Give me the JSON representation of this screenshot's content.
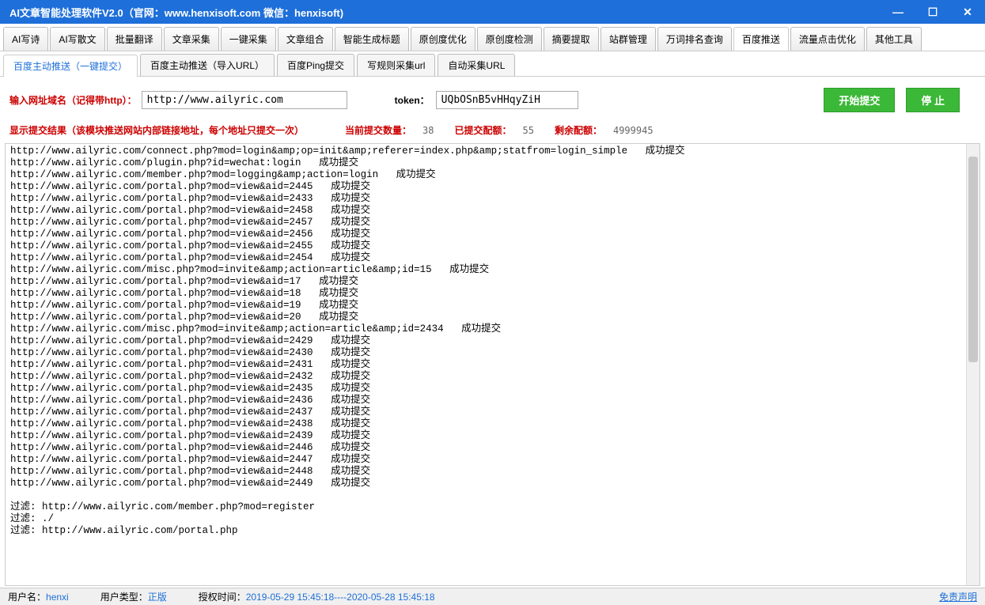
{
  "title": "AI文章智能处理软件V2.0（官网：www.henxisoft.com  微信：henxisoft)",
  "mainTabs": [
    "AI写诗",
    "AI写散文",
    "批量翻译",
    "文章采集",
    "一键采集",
    "文章组合",
    "智能生成标题",
    "原创度优化",
    "原创度检测",
    "摘要提取",
    "站群管理",
    "万词排名查询",
    "百度推送",
    "流量点击优化",
    "其他工具"
  ],
  "mainTabActive": 12,
  "subTabs": [
    "百度主动推送（一键提交）",
    "百度主动推送（导入URL）",
    "百度Ping提交",
    "写规则采集url",
    "自动采集URL"
  ],
  "subTabActive": 0,
  "form": {
    "urlLabel": "输入网址域名（记得带http）：",
    "urlValue": "http://www.ailyric.com",
    "tokenLabel": "token：",
    "tokenValue": "UQbOSnB5vHHqyZiH",
    "startBtn": "开始提交",
    "stopBtn": "停 止"
  },
  "stats": {
    "resultLabel": "显示提交结果（该模块推送网站内部链接地址，每个地址只提交一次）",
    "currentLabel": "当前提交数量：",
    "currentValue": "38",
    "submittedLabel": "已提交配额：",
    "submittedValue": "55",
    "remainLabel": "剩余配额：",
    "remainValue": "4999945"
  },
  "log": [
    "http://www.ailyric.com/connect.php?mod=login&amp;op=init&amp;referer=index.php&amp;statfrom=login_simple   成功提交",
    "http://www.ailyric.com/plugin.php?id=wechat:login   成功提交",
    "http://www.ailyric.com/member.php?mod=logging&amp;action=login   成功提交",
    "http://www.ailyric.com/portal.php?mod=view&aid=2445   成功提交",
    "http://www.ailyric.com/portal.php?mod=view&aid=2433   成功提交",
    "http://www.ailyric.com/portal.php?mod=view&aid=2458   成功提交",
    "http://www.ailyric.com/portal.php?mod=view&aid=2457   成功提交",
    "http://www.ailyric.com/portal.php?mod=view&aid=2456   成功提交",
    "http://www.ailyric.com/portal.php?mod=view&aid=2455   成功提交",
    "http://www.ailyric.com/portal.php?mod=view&aid=2454   成功提交",
    "http://www.ailyric.com/misc.php?mod=invite&amp;action=article&amp;id=15   成功提交",
    "http://www.ailyric.com/portal.php?mod=view&aid=17   成功提交",
    "http://www.ailyric.com/portal.php?mod=view&aid=18   成功提交",
    "http://www.ailyric.com/portal.php?mod=view&aid=19   成功提交",
    "http://www.ailyric.com/portal.php?mod=view&aid=20   成功提交",
    "http://www.ailyric.com/misc.php?mod=invite&amp;action=article&amp;id=2434   成功提交",
    "http://www.ailyric.com/portal.php?mod=view&aid=2429   成功提交",
    "http://www.ailyric.com/portal.php?mod=view&aid=2430   成功提交",
    "http://www.ailyric.com/portal.php?mod=view&aid=2431   成功提交",
    "http://www.ailyric.com/portal.php?mod=view&aid=2432   成功提交",
    "http://www.ailyric.com/portal.php?mod=view&aid=2435   成功提交",
    "http://www.ailyric.com/portal.php?mod=view&aid=2436   成功提交",
    "http://www.ailyric.com/portal.php?mod=view&aid=2437   成功提交",
    "http://www.ailyric.com/portal.php?mod=view&aid=2438   成功提交",
    "http://www.ailyric.com/portal.php?mod=view&aid=2439   成功提交",
    "http://www.ailyric.com/portal.php?mod=view&aid=2446   成功提交",
    "http://www.ailyric.com/portal.php?mod=view&aid=2447   成功提交",
    "http://www.ailyric.com/portal.php?mod=view&aid=2448   成功提交",
    "http://www.ailyric.com/portal.php?mod=view&aid=2449   成功提交",
    "",
    "过滤: http://www.ailyric.com/member.php?mod=register",
    "过滤: ./",
    "过滤: http://www.ailyric.com/portal.php"
  ],
  "status": {
    "userLabel": "用户名：",
    "userValue": "henxi",
    "typeLabel": "用户类型：",
    "typeValue": "正版",
    "authLabel": "授权时间：",
    "authValue": "2019-05-29 15:45:18----2020-05-28 15:45:18",
    "link": "免责声明"
  }
}
